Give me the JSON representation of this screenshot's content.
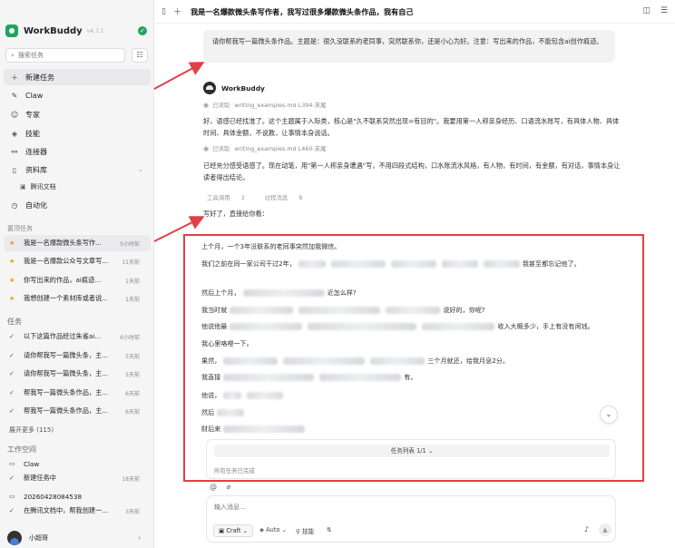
{
  "app": {
    "name": "WorkBuddy",
    "version": "v4.7.1",
    "status_icon": "check-icon",
    "accent": "#22a55b"
  },
  "search": {
    "placeholder": "搜索任务"
  },
  "nav": [
    {
      "label": "新建任务",
      "icon": "plus-icon",
      "active": true
    },
    {
      "label": "Claw",
      "icon": "claw-icon"
    },
    {
      "label": "专家",
      "icon": "expert-icon"
    },
    {
      "label": "技能",
      "icon": "skill-icon"
    },
    {
      "label": "连接器",
      "icon": "connector-icon"
    },
    {
      "label": "资料库",
      "icon": "book-icon"
    }
  ],
  "nav_sub": {
    "label": "腾讯文档",
    "icon": "doc-icon"
  },
  "nav_auto": {
    "label": "自动化",
    "icon": "clock-icon"
  },
  "pinned": {
    "label": "置顶任务",
    "items": [
      {
        "text": "我是一名爆款微头条写作...",
        "time": "5小时前",
        "active": true
      },
      {
        "text": "我是一名爆款公众号文章写...",
        "time": "11天前"
      },
      {
        "text": "你写出来的作品，ai痕迹...",
        "time": "1天前"
      },
      {
        "text": "我想创建一个素材库或者说...",
        "time": "1天前"
      }
    ]
  },
  "tasks": {
    "label": "任务",
    "items": [
      {
        "text": "以下这篇作品经过朱雀ai...",
        "time": "6小时前"
      },
      {
        "text": "请你帮我写一篇微头条，主...",
        "time": "5天前"
      },
      {
        "text": "请你帮我写一篇微头条，主...",
        "time": "5天前"
      },
      {
        "text": "帮我写一篇微头条作品，主...",
        "time": "6天前"
      },
      {
        "text": "帮我写一篇微头条作品，主...",
        "time": "6天前"
      }
    ],
    "more": "展开更多 (115)"
  },
  "workspace": {
    "label": "工作空间",
    "items": [
      {
        "text": "Claw",
        "icon": "folder-icon"
      },
      {
        "text": "新建任务中",
        "time": "18天前",
        "icon": "check-icon"
      },
      {
        "text": "20260428084538",
        "icon": "folder-icon"
      },
      {
        "text": "在腾讯文档中，帮我创建一...",
        "time": "3天前",
        "icon": "check-icon"
      }
    ]
  },
  "user": {
    "name": "小超哥"
  },
  "topbar": {
    "title": "我是一名爆款微头条写作者，我写过很多爆款微头条作品，我有自己"
  },
  "chat": {
    "user_message": "请你帮我写一篇微头条作品。主题是：很久没联系的老同事，突然联系你，还是小心为好。注意：写出来的作品，不能包含ai创作痕迹。",
    "bot_name": "WorkBuddy",
    "read1": {
      "label": "已读取",
      "file": "writing_examples.md  L394-末尾"
    },
    "para1": "好，语感已经找准了。这个主题属于入际类，核心是\"久不联系突然出现=有目的\"。我要用第一人称亲身经历、口语流水账写，有具体人物、具体时间、具体金额，不说教，让事情本身说话。",
    "read2": {
      "label": "已读取",
      "file": "writing_examples.md  L460-末尾"
    },
    "para2": "已经充分感受语感了。现在动笔，用\"第一人称亲身遭遇\"写，不用四段式结构，口水账流水风格，有人物，有时间，有金额，有对话，事情本身让读者得出结论。",
    "tools": {
      "label": "工具调用",
      "count": "3",
      "process": "过程消息",
      "process_count": "8"
    },
    "final": "写好了，直接给你看："
  },
  "output": {
    "lines": [
      "上个月，一个3年没联系的老同事突然加我微信。",
      "我们之前在同一家公司干过2年，",
      "我甚至都忘记他了。",
      "然后上个月，",
      "近怎么样?",
      "我当时就",
      "说好的，你呢?",
      "他说他最",
      "收入大概多少，手上有没有闲钱。",
      "我心里咯噔一下。",
      "果然，",
      "三个月就还，给我月息2分。",
      "我直接",
      "有。",
      "他说，",
      "然后",
      "财后来"
    ]
  },
  "tasklist": {
    "title": "任务列表 1/1",
    "done": "所有任务已完成"
  },
  "composer": {
    "placeholder": "输入消息...",
    "mode": "Craft",
    "model": "Auto",
    "skills": "技能"
  }
}
